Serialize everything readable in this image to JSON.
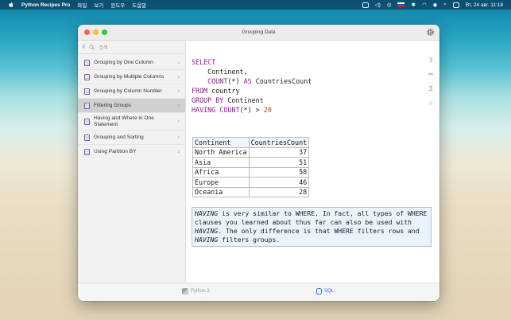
{
  "menubar": {
    "app_name": "Python Recipes Pro",
    "menus": [
      "파일",
      "보기",
      "윈도우",
      "도움말"
    ],
    "clock": "Вт, 24 авг.  11:18"
  },
  "window": {
    "title": "Grouping Data"
  },
  "sidebar": {
    "search_placeholder": "검색",
    "items": [
      {
        "label": "Grouping by One Column"
      },
      {
        "label": "Grouping by Multiple Columns"
      },
      {
        "label": "Grouping by Column Number"
      },
      {
        "label": "Filtering Groups",
        "selected": true
      },
      {
        "label": "Having and Where in One Statement"
      },
      {
        "label": "Grouping and Sorting"
      },
      {
        "label": "Using Partition BY"
      }
    ]
  },
  "code": {
    "l1_kw": "SELECT",
    "l2": "    Continent,",
    "l3_kw": "    COUNT",
    "l3_rest": "(*) ",
    "l3_kw2": "AS",
    "l3_tail": " CountriesCount",
    "l4_kw": "FROM",
    "l4_rest": " country",
    "l5_kw": "GROUP BY",
    "l5_rest": " Continent",
    "l6_kw": "HAVING COUNT",
    "l6_rest": "(*) > ",
    "l6_num": "20"
  },
  "result_table": {
    "headers": [
      "Continent",
      "CountriesCount"
    ],
    "rows": [
      [
        "North America",
        "37"
      ],
      [
        "Asia",
        "51"
      ],
      [
        "Africa",
        "58"
      ],
      [
        "Europe",
        "46"
      ],
      [
        "Oceania",
        "28"
      ]
    ]
  },
  "note": {
    "t1": "HAVING",
    "t2": " is very similar to WHERE. In fact, all types of WHERE clauses you learned about thus far can also be used with ",
    "t3": "HAVING",
    "t4": ". The only difference is that WHERE filters rows and ",
    "t5": "HAVING",
    "t6": " filters groups."
  },
  "bottom_tabs": {
    "python_label": "Python 3",
    "sql_label": "SQL",
    "selected": "SQL"
  },
  "colors": {
    "accent": "#2b6ee8",
    "keyword": "#8c1a8c",
    "number": "#a0522d"
  }
}
